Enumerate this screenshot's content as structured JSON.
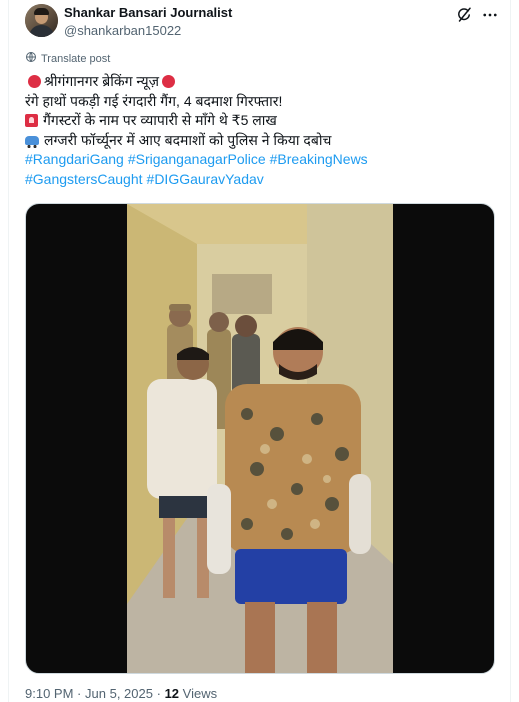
{
  "author": {
    "name": "Shankar Bansari Journalist",
    "handle": "@shankarban15022"
  },
  "translate_label": "Translate post",
  "post": {
    "line1_text": "श्रीगंगानगर ब्रेकिंग न्यूज़",
    "line2_text": "रंगे हाथों पकड़ी गई रंगदारी गैंग, 4 बदमाश गिरफ्तार!",
    "line3_text": "गैंगस्टरों के नाम पर व्यापारी से माँगे थे ₹5 लाख",
    "line4_text": "लग्जरी फॉर्च्यूनर में आए बदमाशों को पुलिस ने किया दबोच",
    "hashtags_row1": [
      "#RangdariGang",
      "#SriganganagarPolice",
      "#BreakingNews"
    ],
    "hashtags_row2": [
      "#GangstersCaught",
      "#DIGGauravYadav"
    ]
  },
  "icons": {
    "emoji1": "red-circle",
    "emoji2": "police-light",
    "emoji3": "car",
    "grok": "grok-icon",
    "more": "more-icon",
    "translate": "globe-icon"
  },
  "footer": {
    "time": "9:10 PM",
    "separator1": "·",
    "date": "Jun 5, 2025",
    "separator2": "·",
    "views_count": "12",
    "views_label": "Views"
  },
  "colors": {
    "accent": "#1d9bf0",
    "emoji_red": "#dd2e44",
    "text": "#0f1419",
    "secondary": "#536471"
  }
}
